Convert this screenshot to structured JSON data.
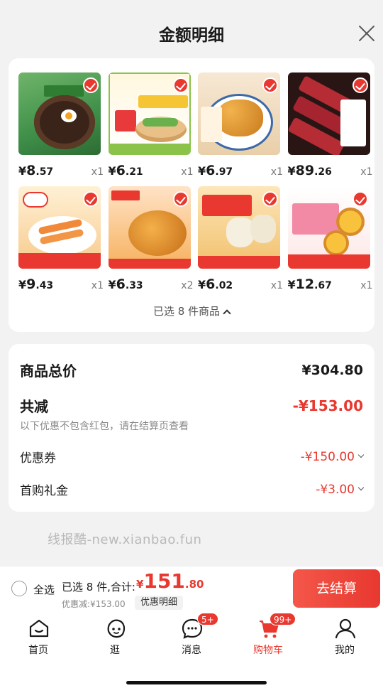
{
  "sheet": {
    "title": "金额明细"
  },
  "products": [
    {
      "thumb": "t1",
      "yen": "¥",
      "int": "8",
      "dec": ".57",
      "qty": "x1"
    },
    {
      "thumb": "t2",
      "yen": "¥",
      "int": "6",
      "dec": ".21",
      "qty": "x1"
    },
    {
      "thumb": "t3",
      "yen": "¥",
      "int": "6",
      "dec": ".97",
      "qty": "x1"
    },
    {
      "thumb": "t4",
      "yen": "¥",
      "int": "89",
      "dec": ".26",
      "qty": "x1"
    },
    {
      "thumb": "t5",
      "yen": "¥",
      "int": "9",
      "dec": ".43",
      "qty": "x1"
    },
    {
      "thumb": "t6",
      "yen": "¥",
      "int": "6",
      "dec": ".33",
      "qty": "x2"
    },
    {
      "thumb": "t7",
      "yen": "¥",
      "int": "6",
      "dec": ".02",
      "qty": "x1"
    },
    {
      "thumb": "t8",
      "yen": "¥",
      "int": "12",
      "dec": ".67",
      "qty": "x1"
    }
  ],
  "products_footer": "已选 8 件商品",
  "summary": {
    "total_label": "商品总价",
    "total_value": "¥304.80",
    "reduce_label": "共减",
    "reduce_value": "-¥153.00",
    "note": "以下优惠不包含红包，请在结算页查看",
    "coupon_label": "优惠券",
    "coupon_value": "-¥150.00",
    "first_label": "首购礼金",
    "first_value": "-¥3.00"
  },
  "watermark": "线报酷-new.xianbao.fun",
  "bottom": {
    "select_all": "全选",
    "selected_count": "已选 8 件,合计:",
    "price_yen": "¥",
    "price_int": "151",
    "price_dec": ".80",
    "discount": "优惠减:¥153.00",
    "detail_chip": "优惠明细",
    "checkout": "去结算"
  },
  "tabs": [
    {
      "label": "首页",
      "icon": "home-icon",
      "badge": ""
    },
    {
      "label": "逛",
      "icon": "face-icon",
      "badge": ""
    },
    {
      "label": "消息",
      "icon": "message-icon",
      "badge": "5+"
    },
    {
      "label": "购物车",
      "icon": "cart-icon",
      "badge": "99+"
    },
    {
      "label": "我的",
      "icon": "profile-icon",
      "badge": ""
    }
  ],
  "colors": {
    "accent": "#e8382f"
  }
}
